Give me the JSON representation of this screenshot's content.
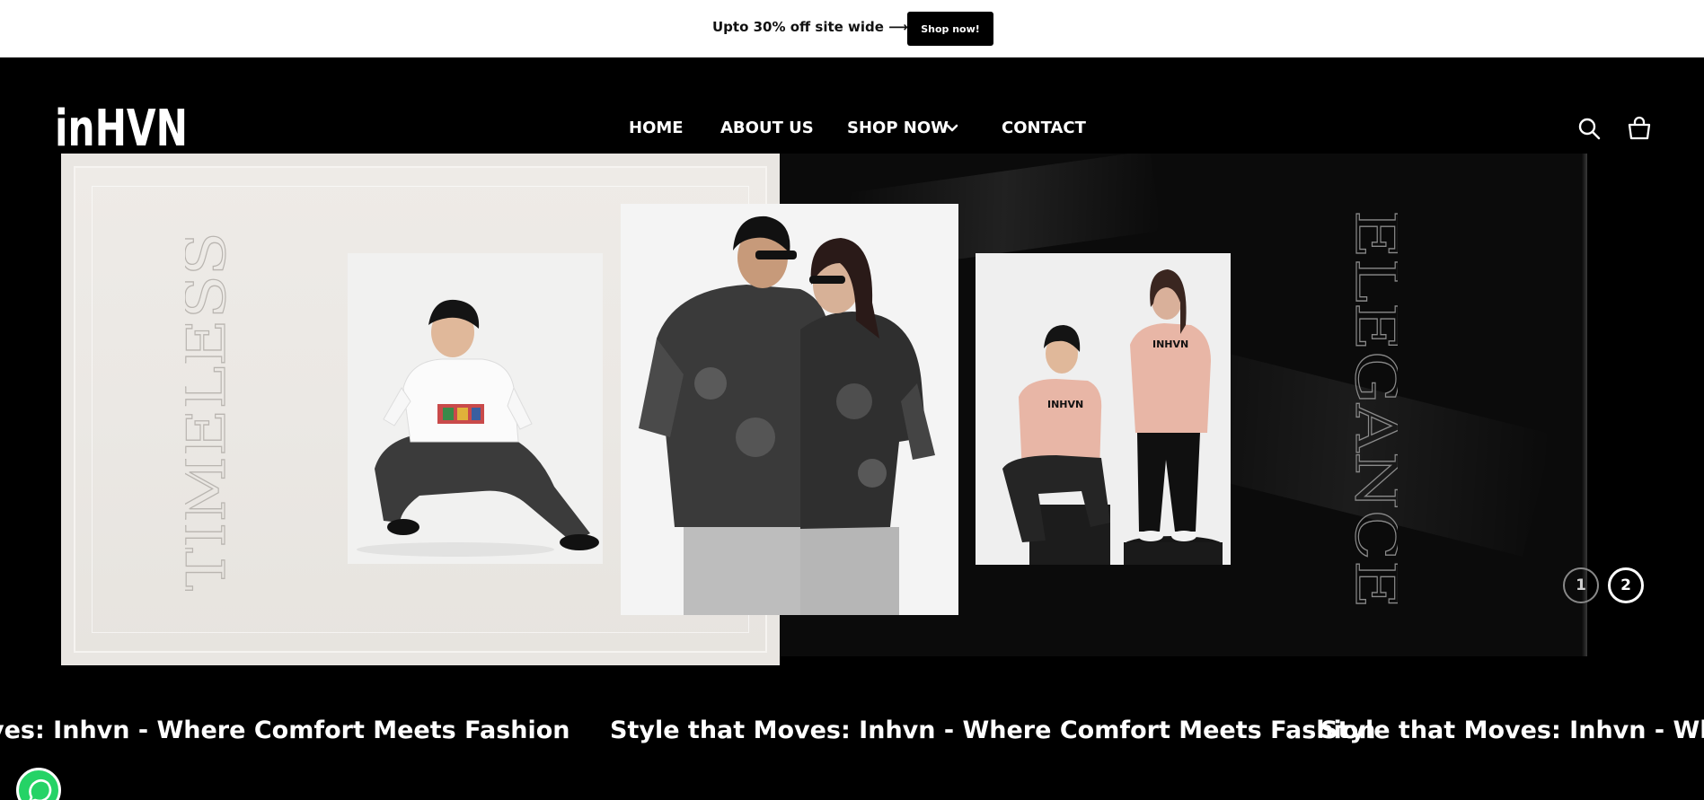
{
  "announcement": {
    "text": "Upto 30% off site wide ⟶",
    "button_label": "Shop now!"
  },
  "header": {
    "logo_text": "inHVN",
    "nav": [
      {
        "label": "HOME"
      },
      {
        "label": "ABOUT US"
      },
      {
        "label": "SHOP NOW"
      },
      {
        "label": "CONTACT"
      }
    ]
  },
  "hero": {
    "left_word": "TIMELESS",
    "right_word": "ELEGANCE",
    "shirt_print": "INHVN",
    "slides": [
      "1",
      "2"
    ],
    "active_slide": 2
  },
  "marquee": {
    "items": [
      "Style that Moves: Inhvn - Where Comfort Meets Fashion",
      "Style that Moves: Inhvn - Where Comfort Meets Fashion",
      "Style that Moves: Inhvn - Where Comfort Meets Fashion"
    ]
  },
  "colors": {
    "background": "#000000",
    "announcement_bg": "#ffffff",
    "left_panel": "#e9e6e2",
    "right_panel": "#0b0b0b",
    "whatsapp": "#25d366"
  },
  "icons": [
    "search-icon",
    "cart-icon",
    "chevron-down-icon",
    "whatsapp-icon"
  ]
}
